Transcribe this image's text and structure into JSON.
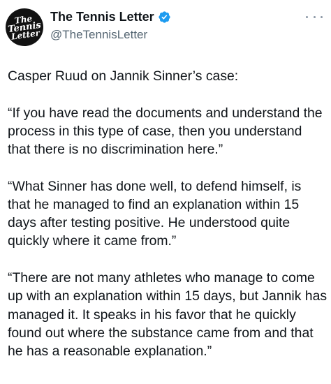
{
  "author": {
    "avatar_lines": [
      "The",
      "Tennis",
      "Letter"
    ],
    "display_name": "The Tennis Letter",
    "handle": "@TheTennisLetter",
    "verified": true,
    "verified_color": "#1d9bf0"
  },
  "icons": {
    "verified": "verified-badge-icon",
    "more": "more-options-icon"
  },
  "tweet": {
    "paragraphs": [
      "Casper Ruud on Jannik Sinner’s case:",
      "“If you have read the documents and understand the process in this type of case, then you understand that there is no discrimination here.”",
      "“What Sinner has done well, to defend himself, is that he managed to find an explanation within 15 days after testing positive. He understood quite quickly where it came from.”",
      "“There are not many athletes who manage to come up with an explanation within 15 days, but Jannik has managed it. It speaks in his favor that he quickly found out where the substance came from and that he has a reasonable explanation.”"
    ]
  }
}
